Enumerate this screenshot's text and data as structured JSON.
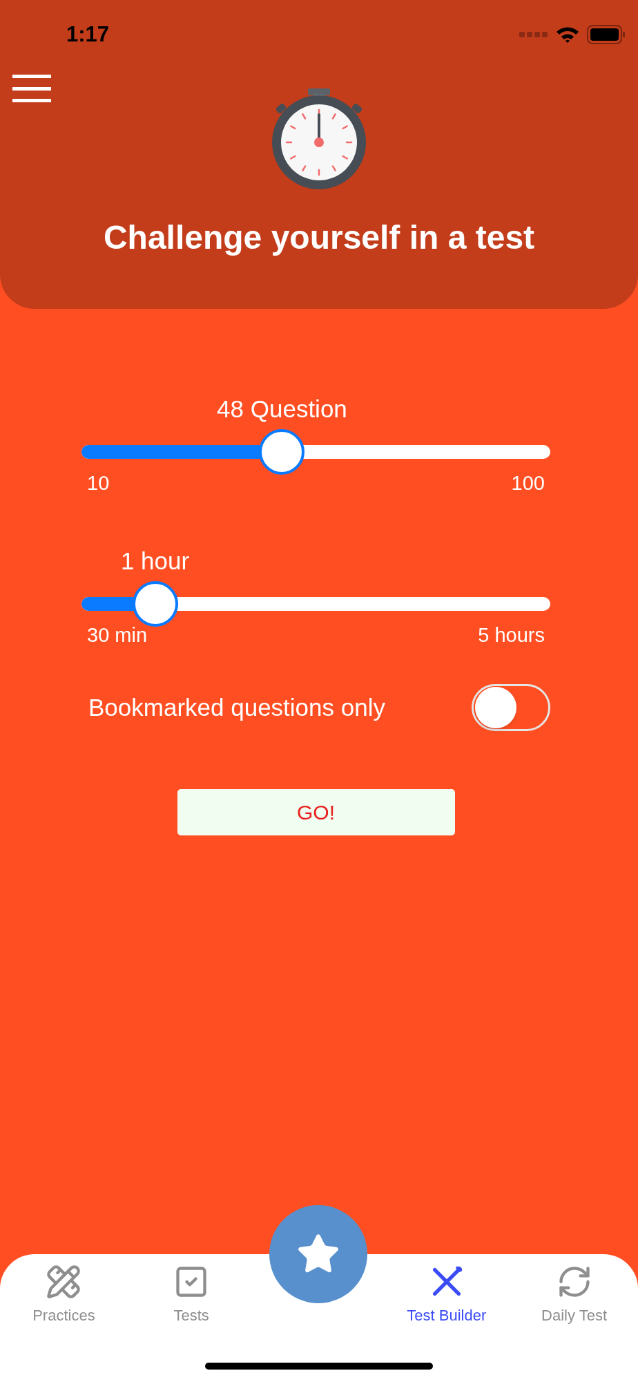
{
  "status_bar": {
    "time": "1:17"
  },
  "header": {
    "title": "Challenge yourself in a test"
  },
  "sliders": [
    {
      "label": "48 Question",
      "level": 0.42,
      "min_label": "10",
      "max_label": "100"
    },
    {
      "label": "1 hour",
      "level": 0.12,
      "min_label": "30 min",
      "max_label": "5 hours"
    }
  ],
  "toggle": {
    "label": "Bookmarked questions only",
    "on": false
  },
  "go_button": {
    "label": "GO!"
  },
  "tabs": [
    {
      "label": "Practices",
      "kind": "practices",
      "selected": false
    },
    {
      "label": "Tests",
      "kind": "tests",
      "selected": false
    },
    {
      "label": "Test Builder",
      "kind": "builder",
      "selected": true
    },
    {
      "label": "Daily Test",
      "kind": "daily",
      "selected": false
    }
  ]
}
